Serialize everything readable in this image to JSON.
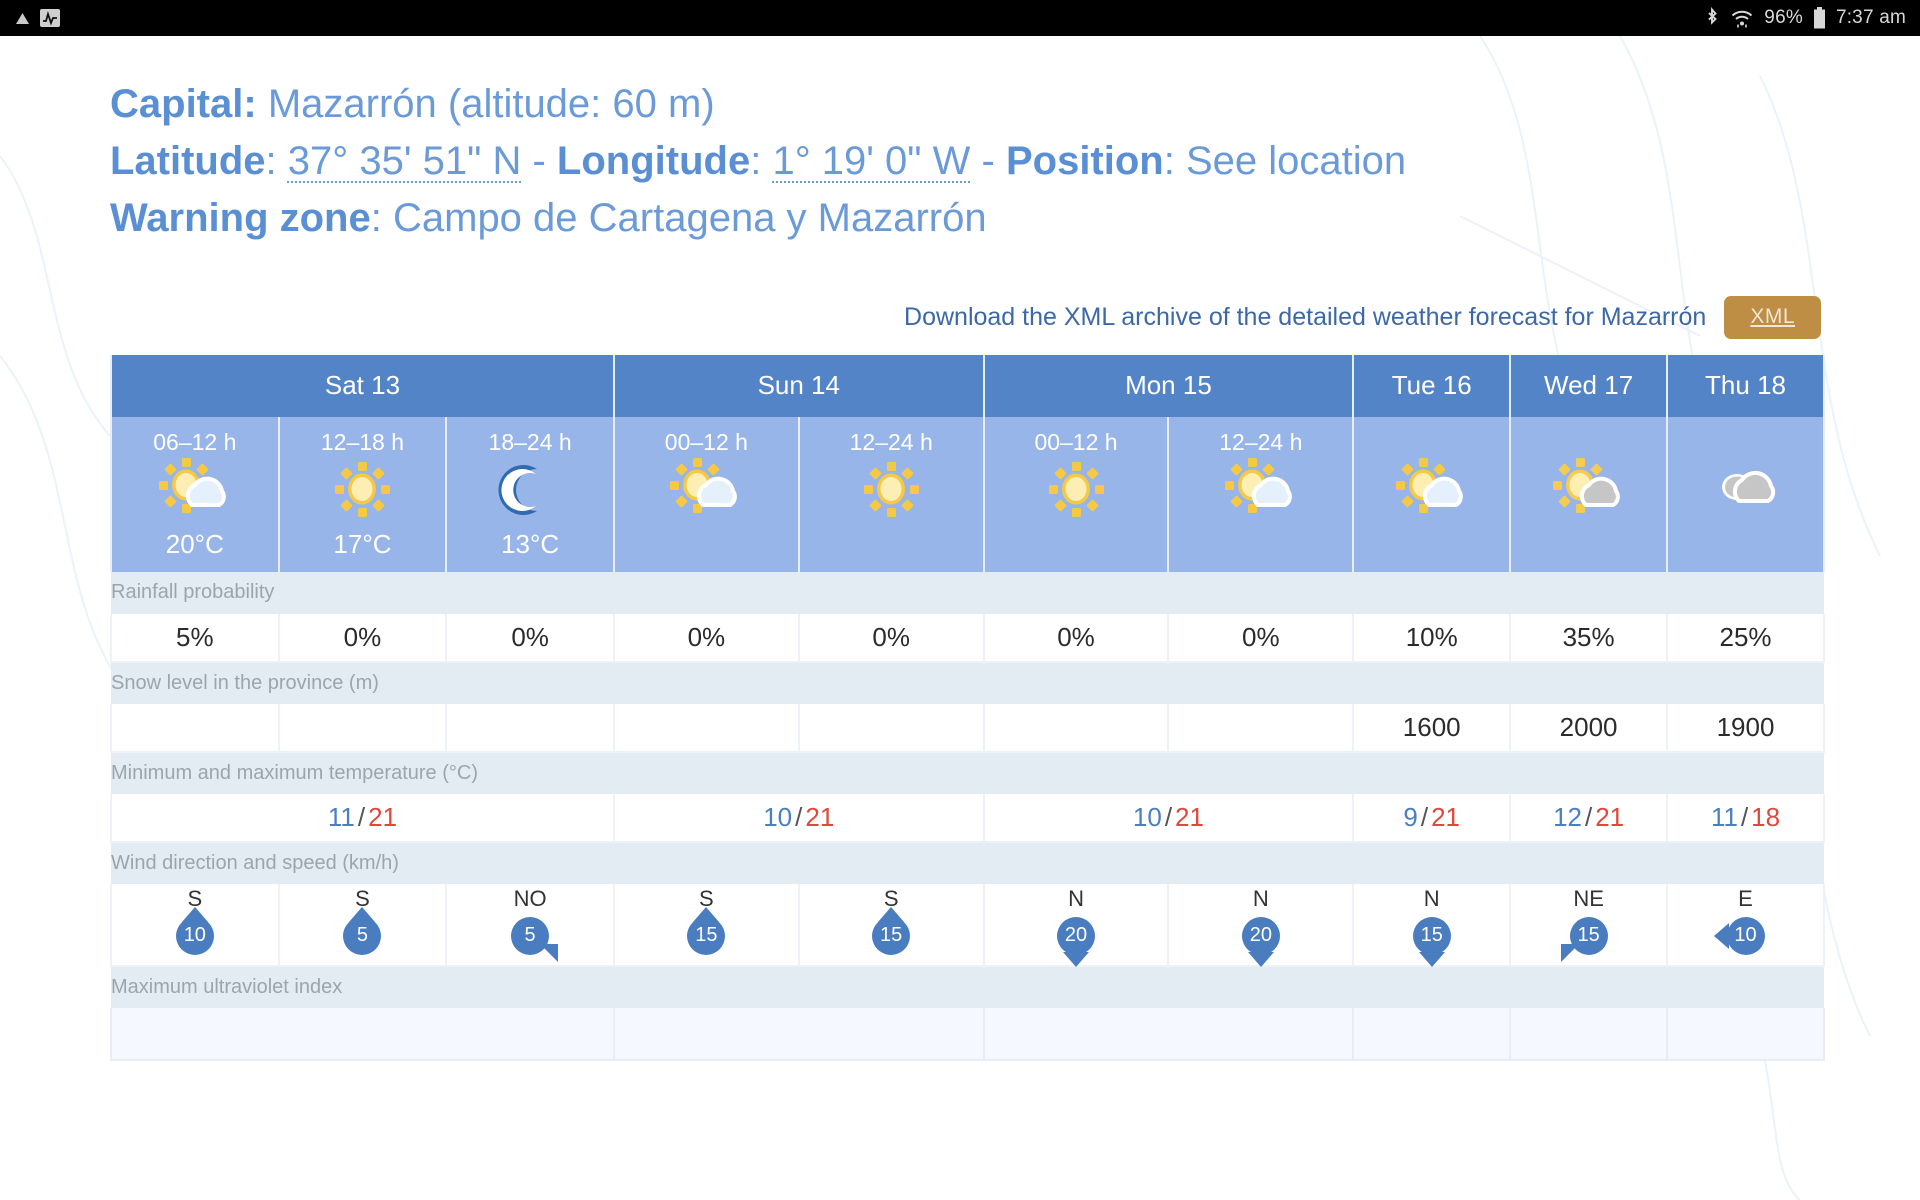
{
  "statusbar": {
    "icons_left": [
      "triangle-up-icon",
      "pulse-icon"
    ],
    "bluetooth_icon": "bluetooth-icon",
    "wifi_icon": "wifi-icon",
    "battery_percent": "96%",
    "battery_icon": "battery-icon",
    "time": "7:37 am"
  },
  "info": {
    "capital_label": "Capital:",
    "capital_value": "Mazarrón (altitude: 60 m)",
    "latitude_label": "Latitude",
    "latitude_value": "37° 35' 51\" N",
    "longitude_label": "Longitude",
    "longitude_value": "1° 19' 0\" W",
    "position_label": "Position",
    "position_value": "See location",
    "warning_zone_label": "Warning zone",
    "warning_zone_value": "Campo de Cartagena y Mazarrón",
    "separator": "-",
    "colon": ":"
  },
  "download": {
    "label": "Download the XML archive of the detailed weather forecast for Mazarrón",
    "badge": "XML",
    "badge_color": "#bf8e45"
  },
  "table": {
    "days": [
      {
        "label": "Sat 13",
        "span": 3
      },
      {
        "label": "Sun 14",
        "span": 2
      },
      {
        "label": "Mon 15",
        "span": 2
      },
      {
        "label": "Tue 16",
        "span": 1
      },
      {
        "label": "Wed 17",
        "span": 1
      },
      {
        "label": "Thu 18",
        "span": 1
      }
    ],
    "slots": [
      {
        "time": "06–12 h",
        "icon": "sun-cloud-icon",
        "temp": "20°C"
      },
      {
        "time": "12–18 h",
        "icon": "sun-icon",
        "temp": "17°C"
      },
      {
        "time": "18–24 h",
        "icon": "moon-icon",
        "temp": "13°C"
      },
      {
        "time": "00–12 h",
        "icon": "sun-cloud-icon",
        "temp": ""
      },
      {
        "time": "12–24 h",
        "icon": "sun-icon",
        "temp": ""
      },
      {
        "time": "00–12 h",
        "icon": "sun-icon",
        "temp": ""
      },
      {
        "time": "12–24 h",
        "icon": "sun-cloud-icon",
        "temp": ""
      },
      {
        "time": "",
        "icon": "sun-cloud-icon",
        "temp": ""
      },
      {
        "time": "",
        "icon": "sun-cloud-gray-icon",
        "temp": ""
      },
      {
        "time": "",
        "icon": "cloud-gray-icon",
        "temp": ""
      }
    ],
    "rows": {
      "rainfall": {
        "label": "Rainfall probability",
        "values": [
          "5%",
          "0%",
          "0%",
          "0%",
          "0%",
          "0%",
          "0%",
          "10%",
          "35%",
          "25%"
        ]
      },
      "snow": {
        "label": "Snow level in the province (m)",
        "values": [
          "",
          "",
          "",
          "",
          "",
          "",
          "",
          "1600",
          "2000",
          "1900"
        ]
      },
      "minmax": {
        "label": "Minimum and maximum temperature (°C)",
        "values": [
          {
            "min": "11",
            "max": "21",
            "span": 3
          },
          {
            "min": "10",
            "max": "21",
            "span": 2
          },
          {
            "min": "10",
            "max": "21",
            "span": 2
          },
          {
            "min": "9",
            "max": "21",
            "span": 1
          },
          {
            "min": "12",
            "max": "21",
            "span": 1
          },
          {
            "min": "11",
            "max": "18",
            "span": 1
          }
        ],
        "separator": "/",
        "min_color": "#4a7fc1",
        "max_color": "#e0483c"
      },
      "wind": {
        "label": "Wind direction and speed (km/h)",
        "values": [
          {
            "dir": "S",
            "speed": "10",
            "arrow": "up"
          },
          {
            "dir": "S",
            "speed": "5",
            "arrow": "up"
          },
          {
            "dir": "NO",
            "speed": "5",
            "arrow": "down-right"
          },
          {
            "dir": "S",
            "speed": "15",
            "arrow": "up"
          },
          {
            "dir": "S",
            "speed": "15",
            "arrow": "up"
          },
          {
            "dir": "N",
            "speed": "20",
            "arrow": "down"
          },
          {
            "dir": "N",
            "speed": "20",
            "arrow": "down"
          },
          {
            "dir": "N",
            "speed": "15",
            "arrow": "down"
          },
          {
            "dir": "NE",
            "speed": "15",
            "arrow": "down-left"
          },
          {
            "dir": "E",
            "speed": "10",
            "arrow": "left"
          }
        ]
      },
      "uv": {
        "label": "Maximum ultraviolet index",
        "values": [
          "",
          "",
          "",
          "",
          "",
          ""
        ]
      }
    }
  }
}
